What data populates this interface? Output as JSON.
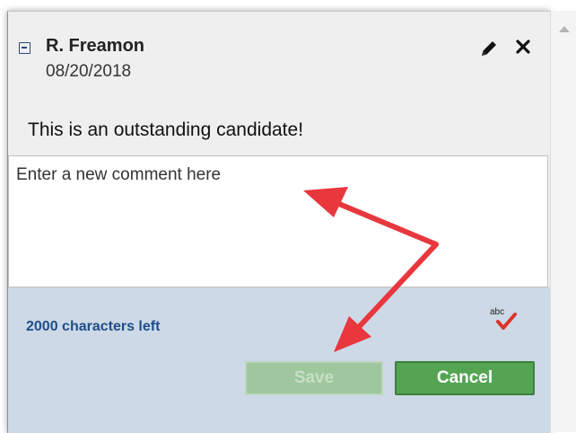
{
  "comment": {
    "author": "R. Freamon",
    "date": "08/20/2018",
    "text": "This is an outstanding candidate!"
  },
  "editor": {
    "placeholder": "Enter a new comment here",
    "value": ""
  },
  "footer": {
    "chars_left": "2000 characters left",
    "spellcheck_label": "abc",
    "save_label": "Save",
    "cancel_label": "Cancel"
  },
  "icons": {
    "collapse": "collapse-minus-icon",
    "edit": "pencil-icon",
    "delete": "close-icon",
    "spellcheck": "spellcheck-icon"
  },
  "colors": {
    "footer_bg": "#cdd9e6",
    "cancel_button": "#55a454",
    "save_button_disabled": "#9ec79d",
    "chars_left_text": "#1f4e8a",
    "annotation_arrow": "#e8373d"
  }
}
